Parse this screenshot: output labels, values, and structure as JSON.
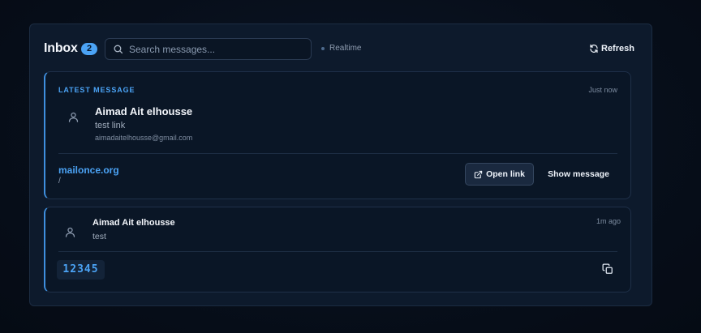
{
  "header": {
    "title": "Inbox",
    "count": "2",
    "search_placeholder": "Search messages...",
    "realtime_label": "Realtime",
    "refresh_label": "Refresh"
  },
  "latest": {
    "section_label": "LATEST MESSAGE",
    "time": "Just now",
    "sender": "Aimad Ait elhousse",
    "subject": "test link",
    "email": "aimadaitelhousse@gmail.com",
    "link_domain": "mailonce.org",
    "link_path": "/",
    "open_link_label": "Open link",
    "show_message_label": "Show message"
  },
  "messages": [
    {
      "sender": "Aimad Ait elhousse",
      "subject": "test",
      "time": "1m ago",
      "code": "12345"
    }
  ],
  "icons": {
    "search": "search-icon",
    "refresh": "refresh-icon",
    "avatar": "user-icon",
    "external": "external-link-icon",
    "copy": "copy-icon"
  },
  "colors": {
    "accent": "#4ba3f5",
    "background": "#070e1a",
    "panel": "#0d1a2c",
    "card": "#0a1626"
  }
}
